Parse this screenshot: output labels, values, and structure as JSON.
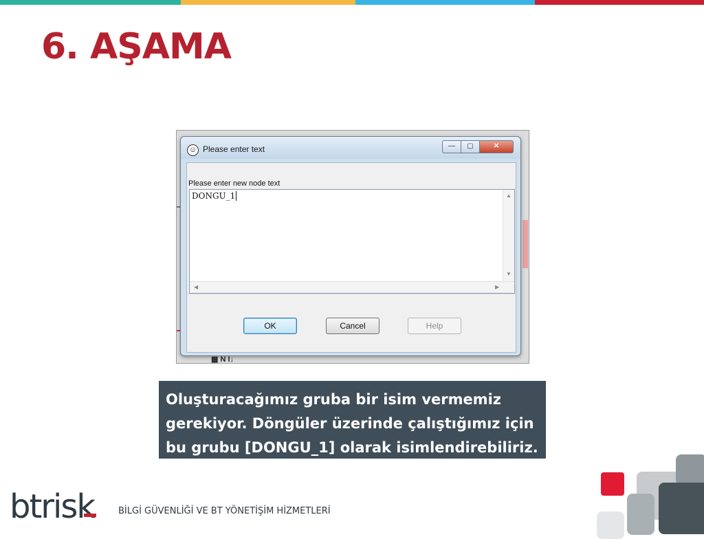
{
  "slide": {
    "title": "6. AŞAMA",
    "top_bar_colors": [
      "#2eb3a0",
      "#f5b840",
      "#39b3e5",
      "#c9202f"
    ]
  },
  "dialog": {
    "title": "Please enter text",
    "app_icon": "app-icon",
    "controls": {
      "minimize": "—",
      "maximize": "▢",
      "close": "✕"
    },
    "prompt": "Please enter new node text",
    "text_value": "DONGU_1",
    "buttons": {
      "ok": "OK",
      "cancel": "Cancel",
      "help": "Help"
    }
  },
  "caption": {
    "lines": [
      "Oluşturacağımız gruba bir isim vermemiz",
      "gerekiyor. Döngüler üzerinde çalıştığımız için",
      "bu grubu [DONGU_1] olarak isimlendirebiliriz."
    ]
  },
  "footer": {
    "brand": "btrisk",
    "tagline": "BİLGİ GÜVENLİĞİ VE BT YÖNETİŞİM HİZMETLERİ",
    "accent_color": "#c9202f",
    "brand_color": "#2e3b45"
  }
}
